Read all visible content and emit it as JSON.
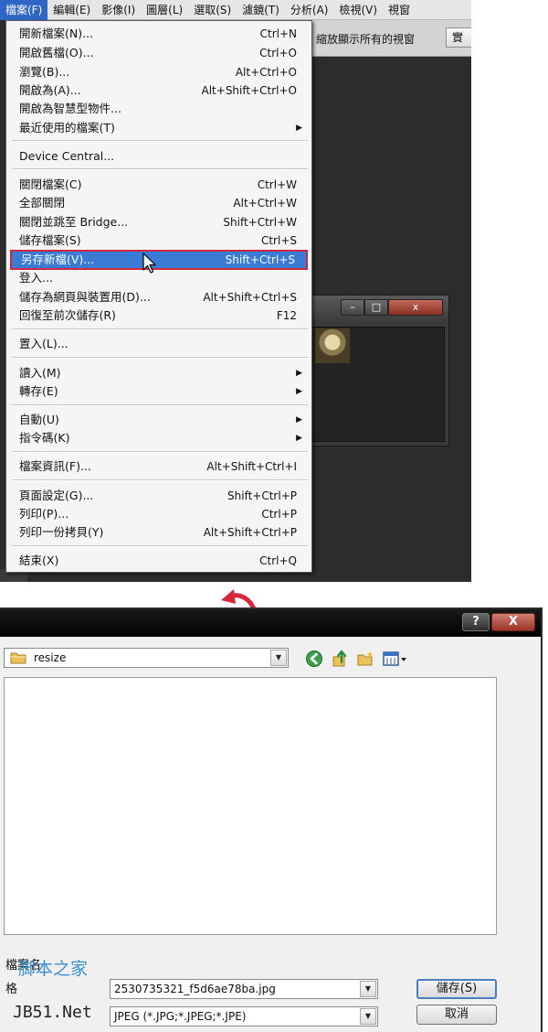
{
  "menubar": {
    "items": [
      "檔案(F)",
      "編輯(E)",
      "影像(I)",
      "圖層(L)",
      "選取(S)",
      "濾鏡(T)",
      "分析(A)",
      "檢視(V)",
      "視窗"
    ]
  },
  "options_bar": {
    "text": "縮放顯示所有的視窗",
    "button": "實"
  },
  "file_menu": {
    "items": [
      {
        "label": "開新檔案(N)...",
        "shortcut": "Ctrl+N"
      },
      {
        "label": "開啟舊檔(O)...",
        "shortcut": "Ctrl+O"
      },
      {
        "label": "瀏覽(B)...",
        "shortcut": "Alt+Ctrl+O"
      },
      {
        "label": "開啟為(A)...",
        "shortcut": "Alt+Shift+Ctrl+O"
      },
      {
        "label": "開啟為智慧型物件...",
        "shortcut": ""
      },
      {
        "label": "最近使用的檔案(T)",
        "shortcut": ""
      },
      {
        "label": "Device Central...",
        "shortcut": ""
      },
      {
        "label": "關閉檔案(C)",
        "shortcut": "Ctrl+W"
      },
      {
        "label": "全部關閉",
        "shortcut": "Alt+Ctrl+W"
      },
      {
        "label": "關閉並跳至 Bridge...",
        "shortcut": "Shift+Ctrl+W"
      },
      {
        "label": "儲存檔案(S)",
        "shortcut": "Ctrl+S"
      },
      {
        "label": "另存新檔(V)...",
        "shortcut": "Shift+Ctrl+S"
      },
      {
        "label": "登入...",
        "shortcut": ""
      },
      {
        "label": "儲存為網頁與裝置用(D)...",
        "shortcut": "Alt+Shift+Ctrl+S"
      },
      {
        "label": "回復至前次儲存(R)",
        "shortcut": "F12"
      },
      {
        "label": "置入(L)...",
        "shortcut": ""
      },
      {
        "label": "讀入(M)",
        "shortcut": ""
      },
      {
        "label": "轉存(E)",
        "shortcut": ""
      },
      {
        "label": "自動(U)",
        "shortcut": ""
      },
      {
        "label": "指令碼(K)",
        "shortcut": ""
      },
      {
        "label": "檔案資訊(F)...",
        "shortcut": "Alt+Shift+Ctrl+I"
      },
      {
        "label": "頁面設定(G)...",
        "shortcut": "Shift+Ctrl+P"
      },
      {
        "label": "列印(P)...",
        "shortcut": "Ctrl+P"
      },
      {
        "label": "列印一份拷貝(Y)",
        "shortcut": "Alt+Shift+Ctrl+P"
      },
      {
        "label": "結束(X)",
        "shortcut": "Ctrl+Q"
      }
    ],
    "highlighted_item": "另存新檔(V)..."
  },
  "save_dialog": {
    "help_button": "?",
    "close_button": "X",
    "location": "resize",
    "filename_label": "檔案名",
    "filetype_label": "格",
    "filename_value": "2530735321_f5d6ae78ba.jpg",
    "filetype_value": "JPEG (*.JPG;*.JPEG;*.JPE)",
    "save_button": "儲存(S)",
    "cancel_button": "取消"
  },
  "watermark": {
    "line1": "脚本之家",
    "line2": "JB51.Net"
  },
  "colors": {
    "menu_highlight": "#3a7bd5",
    "highlight_border": "#d0273f",
    "arrow": "#d8263b",
    "workspace": "#2c2c2c"
  }
}
